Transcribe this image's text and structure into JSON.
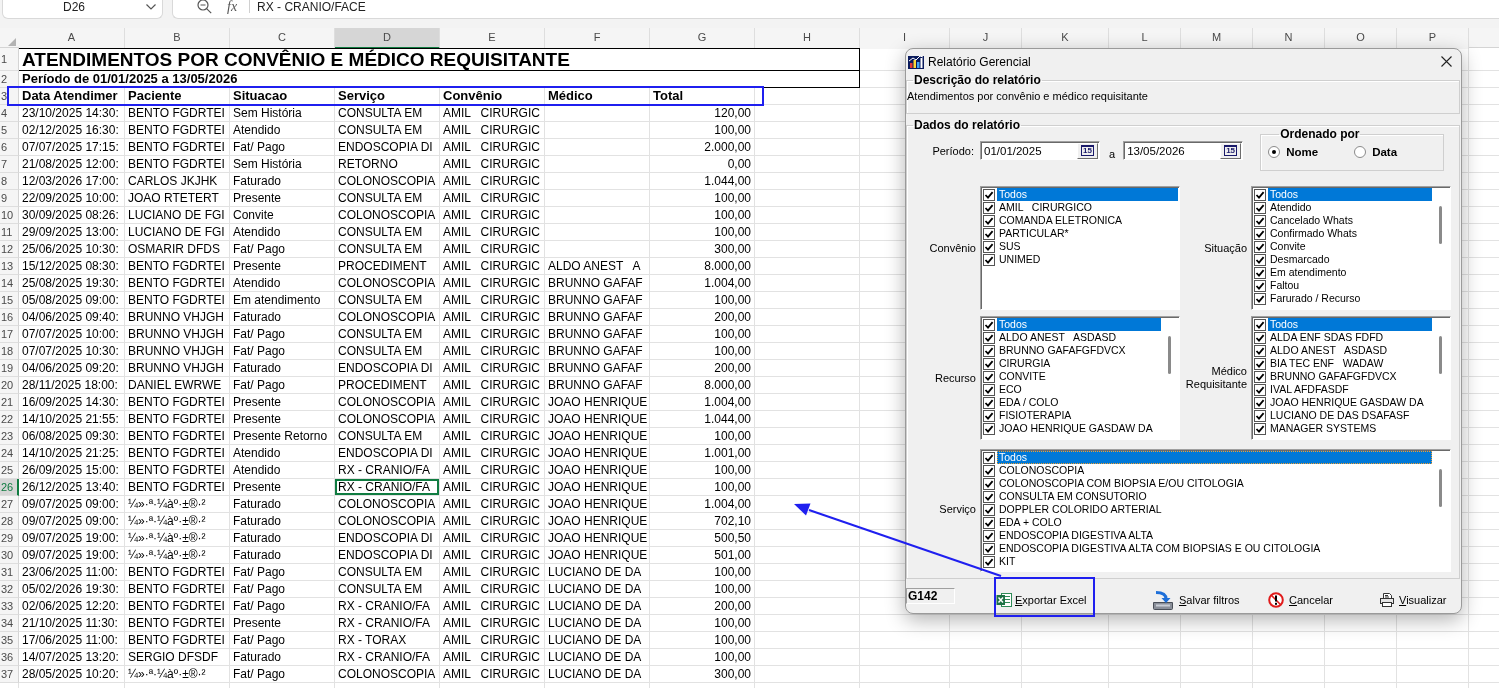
{
  "formula_bar": {
    "name_box": "D26",
    "function_label": "fx",
    "formula": "RX - CRANIO/FACE"
  },
  "sheet": {
    "columns": [
      {
        "label": "A",
        "selected": false
      },
      {
        "label": "B",
        "selected": false
      },
      {
        "label": "C",
        "selected": false
      },
      {
        "label": "D",
        "selected": true
      },
      {
        "label": "E",
        "selected": false
      },
      {
        "label": "F",
        "selected": false
      },
      {
        "label": "G",
        "selected": false
      },
      {
        "label": "H",
        "selected": false
      },
      {
        "label": "I",
        "selected": false
      },
      {
        "label": "J",
        "selected": false
      },
      {
        "label": "K",
        "selected": false
      },
      {
        "label": "L",
        "selected": false
      },
      {
        "label": "M",
        "selected": false
      },
      {
        "label": "N",
        "selected": false
      },
      {
        "label": "O",
        "selected": false
      },
      {
        "label": "P",
        "selected": false
      }
    ],
    "title": {
      "row": "1",
      "text": "ATENDIMENTOS POR CONVÊNIO E MÉDICO REQUISITANTE"
    },
    "period": {
      "row": "2",
      "text": "Período de 01/01/2025 a 13/05/2026"
    },
    "header": {
      "row": "3",
      "highlighted": true,
      "cells": [
        "Data Atendimer",
        "Paciente",
        "Situacao",
        "Serviço",
        "Convênio",
        "Médico",
        "Total"
      ]
    },
    "rows": [
      {
        "row": "4",
        "selected": false,
        "data_atendimento": "23/10/2025 14:30:",
        "paciente": "BENTO FGDRTEI",
        "situacao": "Sem História",
        "servico": "CONSULTA EM",
        "convenio": "AMIL   CIRURGIC",
        "total": "120,00"
      },
      {
        "row": "5",
        "selected": false,
        "data_atendimento": "02/12/2025 16:30:",
        "paciente": "BENTO FGDRTEI",
        "situacao": "Atendido",
        "servico": "CONSULTA EM",
        "convenio": "AMIL   CIRURGIC",
        "total": "100,00"
      },
      {
        "row": "6",
        "selected": false,
        "data_atendimento": "07/07/2025 17:15:",
        "paciente": "BENTO FGDRTEI",
        "situacao": "Fat/ Pago",
        "servico": "ENDOSCOPIA DI",
        "convenio": "AMIL   CIRURGIC",
        "total": "2.000,00"
      },
      {
        "row": "7",
        "selected": false,
        "data_atendimento": "21/08/2025 12:00:",
        "paciente": "BENTO FGDRTEI",
        "situacao": "Sem História",
        "servico": "RETORNO",
        "convenio": "AMIL   CIRURGIC",
        "total": "0,00"
      },
      {
        "row": "8",
        "selected": false,
        "data_atendimento": "12/03/2026 17:00:",
        "paciente": "CARLOS JKJHK",
        "situacao": "Faturado",
        "servico": "COLONOSCOPIA",
        "convenio": "AMIL   CIRURGIC",
        "total": "1.044,00"
      },
      {
        "row": "9",
        "selected": false,
        "data_atendimento": "22/09/2025 10:00:",
        "paciente": "JOAO RTETERT",
        "situacao": "Presente",
        "servico": "CONSULTA EM",
        "convenio": "AMIL   CIRURGIC",
        "total": "100,00"
      },
      {
        "row": "10",
        "selected": false,
        "data_atendimento": "30/09/2025 08:26:",
        "paciente": "LUCIANO DE FGI",
        "situacao": "Convite",
        "servico": "COLONOSCOPIA",
        "convenio": "AMIL   CIRURGIC",
        "total": "100,00"
      },
      {
        "row": "11",
        "selected": false,
        "data_atendimento": "29/09/2025 13:00:",
        "paciente": "LUCIANO DE FGI",
        "situacao": "Atendido",
        "servico": "CONSULTA EM",
        "convenio": "AMIL   CIRURGIC",
        "total": "100,00"
      },
      {
        "row": "12",
        "selected": false,
        "data_atendimento": "25/06/2025 10:30:",
        "paciente": "OSMARIR DFDS",
        "situacao": "Fat/ Pago",
        "servico": "CONSULTA EM",
        "convenio": "AMIL   CIRURGIC",
        "total": "300,00"
      },
      {
        "row": "13",
        "selected": false,
        "data_atendimento": "15/12/2025 08:30:",
        "paciente": "BENTO FGDRTEI",
        "situacao": "Presente",
        "servico": "PROCEDIMENT",
        "convenio": "AMIL   CIRURGIC",
        "medico": "ALDO ANEST   A",
        "total": "8.000,00"
      },
      {
        "row": "14",
        "selected": false,
        "data_atendimento": "25/08/2025 19:30:",
        "paciente": "BENTO FGDRTEI",
        "situacao": "Atendido",
        "servico": "COLONOSCOPIA",
        "convenio": "AMIL   CIRURGIC",
        "medico": "BRUNNO GAFAF",
        "total": "1.004,00"
      },
      {
        "row": "15",
        "selected": false,
        "data_atendimento": "05/08/2025 09:00:",
        "paciente": "BENTO FGDRTEI",
        "situacao": "Em atendimento",
        "servico": "CONSULTA EM",
        "convenio": "AMIL   CIRURGIC",
        "medico": "BRUNNO GAFAF",
        "total": "100,00"
      },
      {
        "row": "16",
        "selected": false,
        "data_atendimento": "04/06/2025 09:40:",
        "paciente": "BRUNNO VHJGH",
        "situacao": "Faturado",
        "servico": "COLONOSCOPIA",
        "convenio": "AMIL   CIRURGIC",
        "medico": "BRUNNO GAFAF",
        "total": "200,00"
      },
      {
        "row": "17",
        "selected": false,
        "data_atendimento": "07/07/2025 10:00:",
        "paciente": "BRUNNO VHJGH",
        "situacao": "Fat/ Pago",
        "servico": "CONSULTA EM",
        "convenio": "AMIL   CIRURGIC",
        "medico": "BRUNNO GAFAF",
        "total": "100,00"
      },
      {
        "row": "18",
        "selected": false,
        "data_atendimento": "07/07/2025 10:30:",
        "paciente": "BRUNNO VHJGH",
        "situacao": "Fat/ Pago",
        "servico": "CONSULTA EM",
        "convenio": "AMIL   CIRURGIC",
        "medico": "BRUNNO GAFAF",
        "total": "100,00"
      },
      {
        "row": "19",
        "selected": false,
        "data_atendimento": "04/06/2025 09:20:",
        "paciente": "BRUNNO VHJGH",
        "situacao": "Faturado",
        "servico": "ENDOSCOPIA DI",
        "convenio": "AMIL   CIRURGIC",
        "medico": "BRUNNO GAFAF",
        "total": "200,00"
      },
      {
        "row": "20",
        "selected": false,
        "data_atendimento": "28/11/2025 18:00:",
        "paciente": "DANIEL EWRWE",
        "situacao": "Fat/ Pago",
        "servico": "PROCEDIMENT",
        "convenio": "AMIL   CIRURGIC",
        "medico": "BRUNNO GAFAF",
        "total": "8.000,00"
      },
      {
        "row": "21",
        "selected": false,
        "data_atendimento": "16/09/2025 14:30:",
        "paciente": "BENTO FGDRTEI",
        "situacao": "Presente",
        "servico": "COLONOSCOPIA",
        "convenio": "AMIL   CIRURGIC",
        "medico": "JOAO HENRIQUE",
        "total": "1.004,00"
      },
      {
        "row": "22",
        "selected": false,
        "data_atendimento": "14/10/2025 21:55:",
        "paciente": "BENTO FGDRTEI",
        "situacao": "Presente",
        "servico": "COLONOSCOPIA",
        "convenio": "AMIL   CIRURGIC",
        "medico": "JOAO HENRIQUE",
        "total": "1.044,00"
      },
      {
        "row": "23",
        "selected": false,
        "data_atendimento": "06/08/2025 09:30:",
        "paciente": "BENTO FGDRTEI",
        "situacao": "Presente Retorno",
        "servico": "CONSULTA EM",
        "convenio": "AMIL   CIRURGIC",
        "medico": "JOAO HENRIQUE",
        "total": "100,00"
      },
      {
        "row": "24",
        "selected": false,
        "data_atendimento": "14/10/2025 21:25:",
        "paciente": "BENTO FGDRTEI",
        "situacao": "Atendido",
        "servico": "ENDOSCOPIA DI",
        "convenio": "AMIL   CIRURGIC",
        "medico": "JOAO HENRIQUE",
        "total": "1.001,00"
      },
      {
        "row": "25",
        "selected": false,
        "data_atendimento": "26/09/2025 15:00:",
        "paciente": "BENTO FGDRTEI",
        "situacao": "Atendido",
        "servico": "RX - CRANIO/FA",
        "convenio": "AMIL   CIRURGIC",
        "medico": "JOAO HENRIQUE",
        "total": "100,00"
      },
      {
        "row": "26",
        "selected": true,
        "data_atendimento": "26/12/2025 13:40:",
        "paciente": "BENTO FGDRTEI",
        "situacao": "Presente",
        "servico": "RX - CRANIO/FA",
        "convenio": "AMIL   CIRURGIC",
        "medico": "JOAO HENRIQUE",
        "total": "100,00"
      },
      {
        "row": "27",
        "selected": false,
        "data_atendimento": "09/07/2025 09:00:",
        "paciente": "¼»·ª·¼àº·±®·²",
        "situacao": "Faturado",
        "servico": "COLONOSCOPIA",
        "convenio": "AMIL   CIRURGIC",
        "medico": "JOAO HENRIQUE",
        "total": "1.004,00"
      },
      {
        "row": "28",
        "selected": false,
        "data_atendimento": "09/07/2025 09:00:",
        "paciente": "¼»·ª·¼àº·±®·²",
        "situacao": "Faturado",
        "servico": "COLONOSCOPIA",
        "convenio": "AMIL   CIRURGIC",
        "medico": "JOAO HENRIQUE",
        "total": "702,10"
      },
      {
        "row": "29",
        "selected": false,
        "data_atendimento": "09/07/2025 19:00:",
        "paciente": "¼»·ª·¼àº·±®·²",
        "situacao": "Faturado",
        "servico": "ENDOSCOPIA DI",
        "convenio": "AMIL   CIRURGIC",
        "medico": "JOAO HENRIQUE",
        "total": "500,50"
      },
      {
        "row": "30",
        "selected": false,
        "data_atendimento": "09/07/2025 19:00:",
        "paciente": "¼»·ª·¼àº·±®·²",
        "situacao": "Faturado",
        "servico": "ENDOSCOPIA DI",
        "convenio": "AMIL   CIRURGIC",
        "medico": "JOAO HENRIQUE",
        "total": "501,00"
      },
      {
        "row": "31",
        "selected": false,
        "data_atendimento": "23/06/2025 11:00:",
        "paciente": "BENTO FGDRTEI",
        "situacao": "Fat/ Pago",
        "servico": "CONSULTA EM",
        "convenio": "AMIL   CIRURGIC",
        "medico": "LUCIANO DE DA",
        "total": "100,00"
      },
      {
        "row": "32",
        "selected": false,
        "data_atendimento": "05/02/2026 19:30:",
        "paciente": "BENTO FGDRTEI",
        "situacao": "Fat/ Pago",
        "servico": "CONSULTA EM",
        "convenio": "AMIL   CIRURGIC",
        "medico": "LUCIANO DE DA",
        "total": "100,00"
      },
      {
        "row": "33",
        "selected": false,
        "data_atendimento": "02/06/2025 12:20:",
        "paciente": "BENTO FGDRTEI",
        "situacao": "Fat/ Pago",
        "servico": "RX - CRANIO/FA",
        "convenio": "AMIL   CIRURGIC",
        "medico": "LUCIANO DE DA",
        "total": "200,00"
      },
      {
        "row": "34",
        "selected": false,
        "data_atendimento": "21/10/2025 11:30:",
        "paciente": "BENTO FGDRTEI",
        "situacao": "Presente",
        "servico": "RX - CRANIO/FA",
        "convenio": "AMIL   CIRURGIC",
        "medico": "LUCIANO DE DA",
        "total": "100,00"
      },
      {
        "row": "35",
        "selected": false,
        "data_atendimento": "17/06/2025 11:00:",
        "paciente": "BENTO FGDRTEI",
        "situacao": "Fat/ Pago",
        "servico": "RX - TORAX",
        "convenio": "AMIL   CIRURGIC",
        "medico": "LUCIANO DE DA",
        "total": "100,00"
      },
      {
        "row": "36",
        "selected": false,
        "data_atendimento": "14/07/2025 13:20:",
        "paciente": "SERGIO DFSDF",
        "situacao": "Faturado",
        "servico": "RX - CRANIO/FA",
        "convenio": "AMIL   CIRURGIC",
        "medico": "LUCIANO DE DA",
        "total": "100,00"
      },
      {
        "row": "37",
        "selected": false,
        "data_atendimento": "28/05/2025 10:20:",
        "paciente": "¼»·ª·¼àº·±®·²",
        "situacao": "Fat/ Pago",
        "servico": "COLONOSCOPIA",
        "convenio": "AMIL   CIRURGIC",
        "medico": "LUCIANO DE DA",
        "total": "300,00"
      }
    ]
  },
  "dialog": {
    "title": "Relatório Gerencial",
    "description_group": {
      "label": "Descrição do relatório",
      "text": "Atendimentos por convênio e médico requisitante"
    },
    "data_group": {
      "label": "Dados do relatório",
      "period": {
        "label": "Período:",
        "start": {
          "value": "01/01/2025",
          "calendar": "15"
        },
        "separator": "a",
        "end": {
          "value": "13/05/2026",
          "calendar": "15"
        }
      },
      "order": {
        "label": "Ordenado por",
        "options": [
          {
            "label": "Nome",
            "selected": true
          },
          {
            "label": "Data",
            "selected": false
          }
        ]
      },
      "lists": [
        {
          "label": "Convênio",
          "focused": false,
          "items": [
            {
              "text": "Todos",
              "checked": true,
              "selected": true
            },
            {
              "text": "AMIL   CIRURGICO",
              "checked": true,
              "selected": false
            },
            {
              "text": "COMANDA ELETRONICA",
              "checked": true,
              "selected": false
            },
            {
              "text": "PARTICULAR*",
              "checked": true,
              "selected": false
            },
            {
              "text": "SUS",
              "checked": true,
              "selected": false
            },
            {
              "text": "UNIMED",
              "checked": true,
              "selected": false
            }
          ]
        },
        {
          "label": "Situação",
          "focused": false,
          "items": [
            {
              "text": "Todos",
              "checked": true,
              "selected": true
            },
            {
              "text": "Atendido",
              "checked": true,
              "selected": false
            },
            {
              "text": "Cancelado Whats",
              "checked": true,
              "selected": false
            },
            {
              "text": "Confirmado Whats",
              "checked": true,
              "selected": false
            },
            {
              "text": "Convite",
              "checked": true,
              "selected": false
            },
            {
              "text": "Desmarcado",
              "checked": true,
              "selected": false
            },
            {
              "text": "Em atendimento",
              "checked": true,
              "selected": false
            },
            {
              "text": "Faltou",
              "checked": true,
              "selected": false
            },
            {
              "text": "Farurado / Recurso",
              "checked": true,
              "selected": false
            }
          ]
        },
        {
          "label": "Recurso",
          "focused": false,
          "items": [
            {
              "text": "Todos",
              "checked": true,
              "selected": true
            },
            {
              "text": "ALDO ANEST   ASDASD",
              "checked": true,
              "selected": false
            },
            {
              "text": "BRUNNO GAFAFGFDVCX",
              "checked": true,
              "selected": false
            },
            {
              "text": "CIRURGIA",
              "checked": true,
              "selected": false
            },
            {
              "text": "CONVITE",
              "checked": true,
              "selected": false
            },
            {
              "text": "ECO",
              "checked": true,
              "selected": false
            },
            {
              "text": "EDA / COLO",
              "checked": true,
              "selected": false
            },
            {
              "text": "FISIOTERAPIA",
              "checked": true,
              "selected": false
            },
            {
              "text": "JOAO HENRIQUE GASDAW DA",
              "checked": true,
              "selected": false
            }
          ]
        },
        {
          "label": "Médico Requisitante",
          "focused": false,
          "items": [
            {
              "text": "Todos",
              "checked": true,
              "selected": true
            },
            {
              "text": "ALDA ENF SDAS FDFD",
              "checked": true,
              "selected": false
            },
            {
              "text": "ALDO ANEST   ASDASD",
              "checked": true,
              "selected": false
            },
            {
              "text": "BIA TEC ENF   WADAW",
              "checked": true,
              "selected": false
            },
            {
              "text": "BRUNNO GAFAFGFDVCX",
              "checked": true,
              "selected": false
            },
            {
              "text": "IVAL AFDFASDF",
              "checked": true,
              "selected": false
            },
            {
              "text": "JOAO HENRIQUE GASDAW DA",
              "checked": true,
              "selected": false
            },
            {
              "text": "LUCIANO DE DAS DSAFASF",
              "checked": true,
              "selected": false
            },
            {
              "text": "MANAGER SYSTEMS",
              "checked": true,
              "selected": false
            }
          ]
        },
        {
          "label": "Serviço",
          "focused": true,
          "items": [
            {
              "text": "Todos",
              "checked": true,
              "selected": true
            },
            {
              "text": "COLONOSCOPIA",
              "checked": true,
              "selected": false
            },
            {
              "text": "COLONOSCOPIA COM BIOPSIA E/OU CITOLOGIA",
              "checked": true,
              "selected": false
            },
            {
              "text": "CONSULTA EM CONSUTORIO",
              "checked": true,
              "selected": false
            },
            {
              "text": "DOPPLER COLORIDO ARTERIAL",
              "checked": true,
              "selected": false
            },
            {
              "text": "EDA + COLO",
              "checked": true,
              "selected": false
            },
            {
              "text": "ENDOSCOPIA DIGESTIVA ALTA",
              "checked": true,
              "selected": false
            },
            {
              "text": "ENDOSCOPIA DIGESTIVA ALTA COM BIOPSIAS E OU CITOLOGIA",
              "checked": true,
              "selected": false
            },
            {
              "text": "KIT",
              "checked": true,
              "selected": false
            }
          ]
        }
      ]
    },
    "status_field": "G142",
    "buttons": [
      {
        "kind": "excel",
        "label": "Exportar Excel",
        "highlighted": true
      },
      {
        "kind": "save",
        "label": "Salvar filtros",
        "highlighted": false
      },
      {
        "kind": "cancel",
        "label": "Cancelar",
        "highlighted": false
      },
      {
        "kind": "print",
        "label": "Visualizar",
        "highlighted": false
      }
    ]
  }
}
